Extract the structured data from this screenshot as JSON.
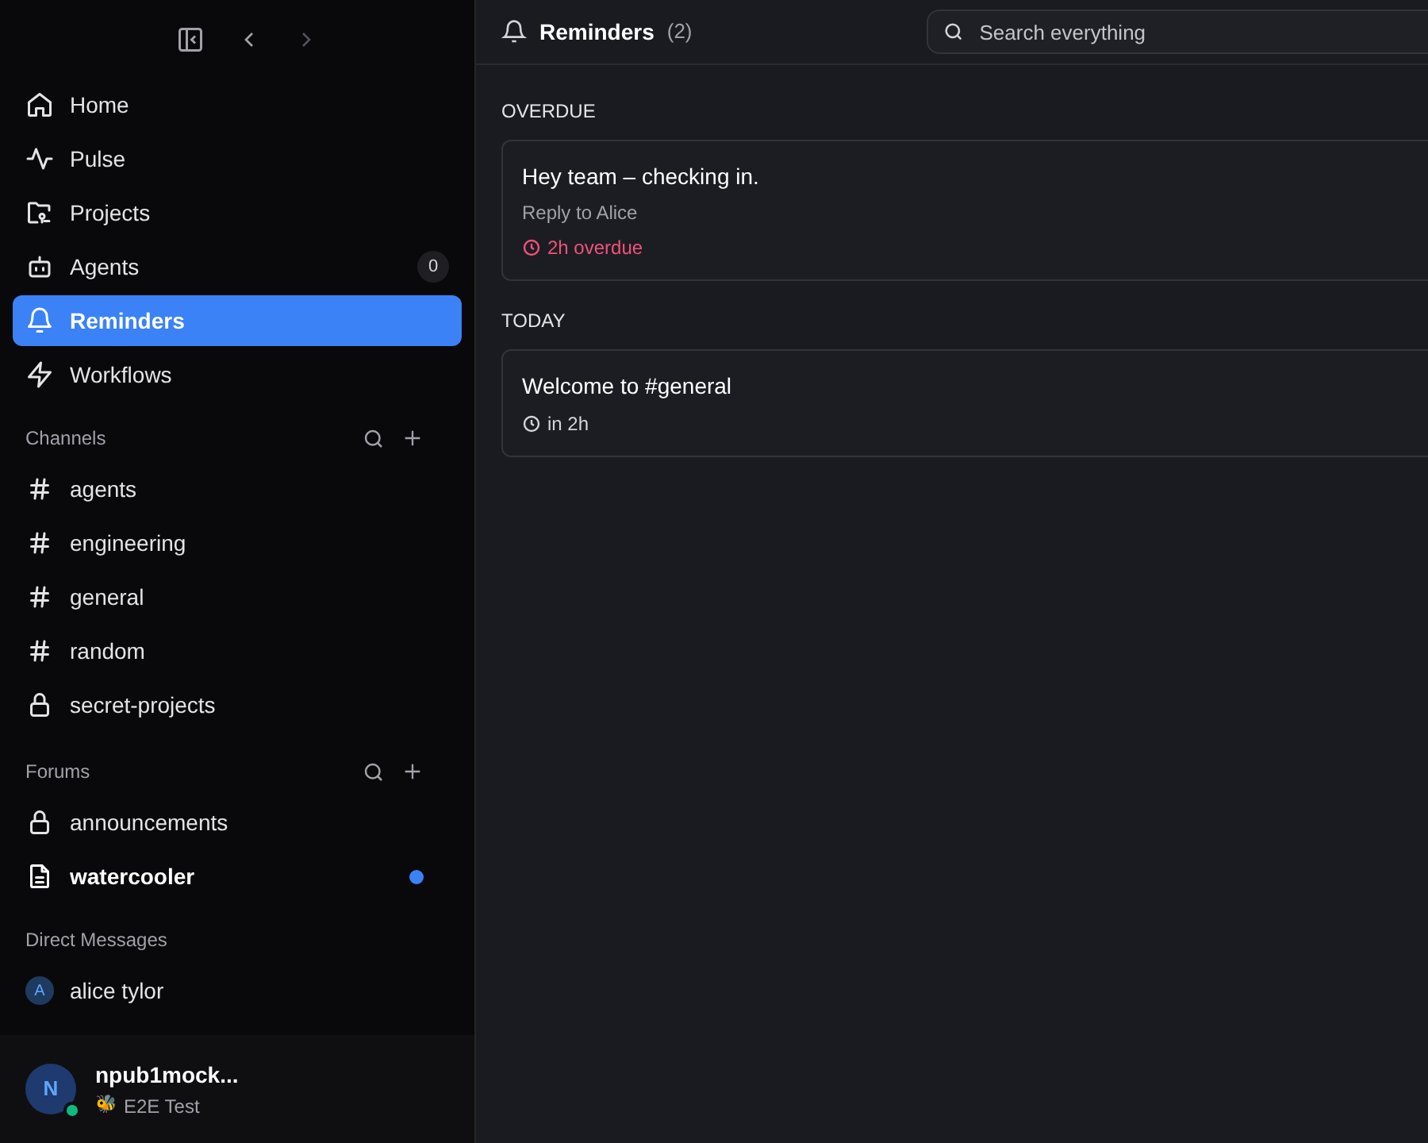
{
  "sidebar": {
    "nav": [
      {
        "label": "Home",
        "selected": false
      },
      {
        "label": "Pulse",
        "selected": false
      },
      {
        "label": "Projects",
        "selected": false
      },
      {
        "label": "Agents",
        "selected": false,
        "badge": "0"
      },
      {
        "label": "Reminders",
        "selected": true
      },
      {
        "label": "Workflows",
        "selected": false
      }
    ],
    "channels": {
      "title": "Channels",
      "items": [
        {
          "label": "agents",
          "private": false
        },
        {
          "label": "engineering",
          "private": false
        },
        {
          "label": "general",
          "private": false
        },
        {
          "label": "random",
          "private": false
        },
        {
          "label": "secret-projects",
          "private": true
        }
      ]
    },
    "forums": {
      "title": "Forums",
      "items": [
        {
          "label": "announcements",
          "private": true,
          "unread": false
        },
        {
          "label": "watercooler",
          "private": false,
          "unread": true
        }
      ]
    },
    "direct_messages": {
      "title": "Direct Messages",
      "items": [
        {
          "initial": "A",
          "label": "alice tylor"
        }
      ]
    },
    "user": {
      "initial": "N",
      "name": "npub1mock...",
      "status_emoji": "🐝",
      "status": "E2E Test",
      "online": true
    }
  },
  "header": {
    "title": "Reminders",
    "count": "(2)",
    "search": {
      "placeholder": "Search everything"
    }
  },
  "groups": [
    {
      "title": "OVERDUE",
      "reminders": [
        {
          "title": "Hey team – checking in.",
          "subtitle": "Reply to Alice",
          "time": "2h overdue",
          "overdue": true
        }
      ]
    },
    {
      "title": "TODAY",
      "reminders": [
        {
          "title": "Welcome to #general",
          "time": "in 2h",
          "overdue": false
        }
      ]
    }
  ]
}
